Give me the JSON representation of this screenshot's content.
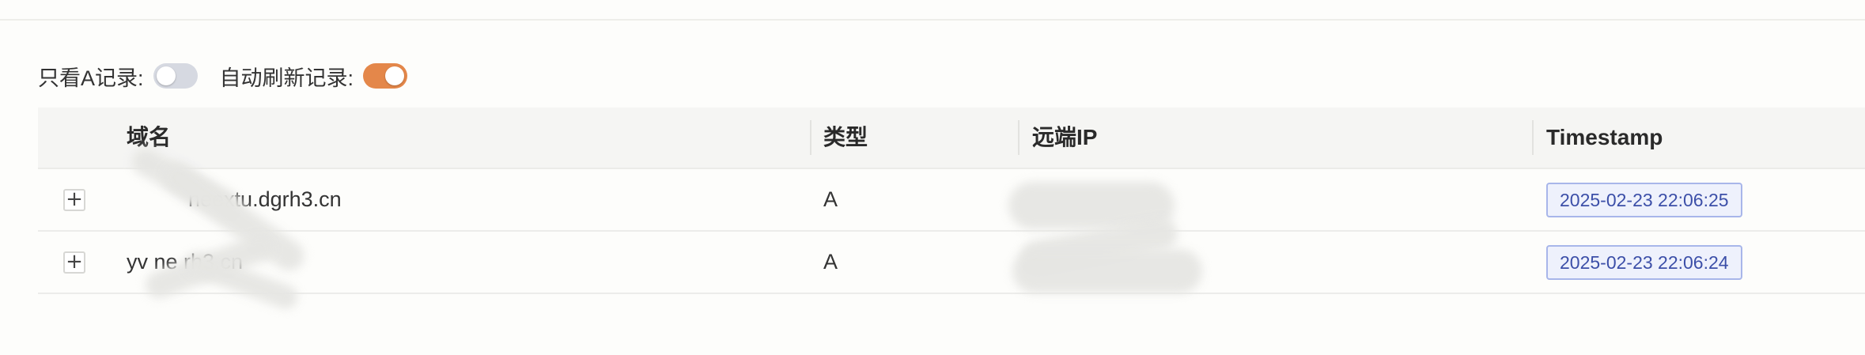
{
  "filters": {
    "a_only_label": "只看A记录:",
    "a_only_on": false,
    "auto_refresh_label": "自动刷新记录:",
    "auto_refresh_on": true
  },
  "table": {
    "columns": {
      "domain": "域名",
      "type": "类型",
      "remote_ip": "远端IP",
      "timestamp": "Timestamp"
    },
    "rows": [
      {
        "expand": "+",
        "domain": "neextu.dgrh3.cn",
        "type": "A",
        "timestamp": "2025-02-23 22:06:25"
      },
      {
        "expand": "+",
        "domain": "yv     ne         rh3.cn",
        "type": "A",
        "timestamp": "2025-02-23 22:06:24"
      }
    ]
  },
  "colors": {
    "switch_on": "#e4874a",
    "switch_off": "#d6d9e1",
    "tag_text": "#3c4fa8",
    "tag_border": "#a8b6ea"
  }
}
